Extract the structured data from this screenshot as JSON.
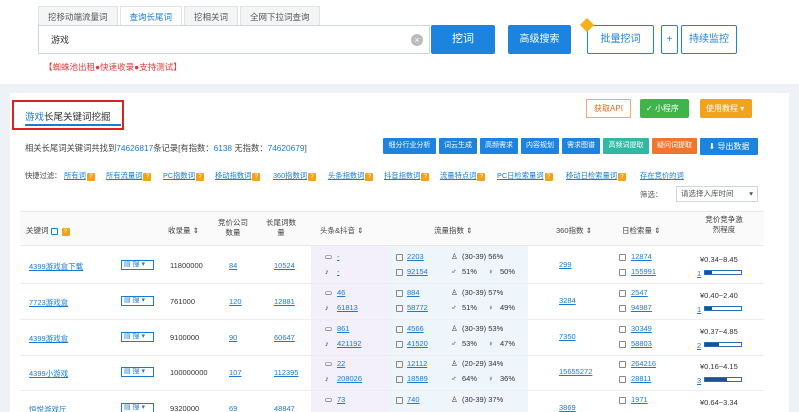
{
  "tabs": [
    "挖移动端流量词",
    "查询长尾词",
    "挖相关词",
    "全网下拉词查询"
  ],
  "search": {
    "value": "游戏"
  },
  "buttons": {
    "dig": "挖词",
    "advanced": "高级搜索",
    "batch": "批量挖词",
    "plus": "+",
    "monitor": "持续监控"
  },
  "promo": "【蜘蛛池出租●快速收录●支持测试】",
  "panel": {
    "title_hl": "游戏",
    "title_rest": "长尾关键词挖掘",
    "get_api": "获取API",
    "mini_program": "小程序",
    "tutorial": "使用教程",
    "summary_pre": "相关长尾词关键词共找到",
    "total": "74626817",
    "summary_mid": "条记录[有指数：",
    "with_index": "6138",
    "summary_mid2": "无指数：",
    "without_index": "74620679",
    "summary_end": "]"
  },
  "tool_buttons": [
    "细分行业分析",
    "词云生成",
    "高频需求",
    "内容规划",
    "需求图谱",
    "高频词提取",
    "疑问词提取",
    "导出数据"
  ],
  "filter": {
    "label": "快捷过滤：",
    "items": [
      "所有词",
      "所有流量词",
      "PC指数词",
      "移动指数词",
      "360指数词",
      "头条指数词",
      "抖音指数词",
      "流量特点词",
      "PC日检索量词",
      "移动日检索量词",
      "存在竞价的词"
    ],
    "select_label": "筛选：",
    "select_value": "请选择入库时间"
  },
  "columns": [
    "关键词",
    "收录量",
    "竞价公司数量",
    "长尾词数量",
    "头条&抖音",
    "流量指数",
    "360指数",
    "日检索量",
    "竞价竞争激烈程度"
  ],
  "rows": [
    {
      "kw": "4399游戏盒下载",
      "shoulu": "11800000",
      "jingjia": "84",
      "changwei": "10524",
      "tt": "-",
      "dy": "-",
      "ll1": "2203",
      "ll2": "92154",
      "age": "(30-39) 56%",
      "male": "51%",
      "female": "50%",
      "s360": "299",
      "day1": "12874",
      "day2": "155991",
      "price": "¥0.34~8.45",
      "level": "1",
      "fill": 0.2
    },
    {
      "kw": "7723游戏盒",
      "shoulu": "761000",
      "jingjia": "120",
      "changwei": "12881",
      "tt": "46",
      "dy": "61813",
      "ll1": "884",
      "ll2": "58772",
      "age": "(30-39) 57%",
      "male": "51%",
      "female": "49%",
      "s360": "3284",
      "day1": "2547",
      "day2": "94987",
      "price": "¥0.40~2.40",
      "level": "1",
      "fill": 0.2
    },
    {
      "kw": "4399游戏盒",
      "shoulu": "9100000",
      "jingjia": "90",
      "changwei": "60647",
      "tt": "861",
      "dy": "421192",
      "ll1": "4566",
      "ll2": "41520",
      "age": "(30-39) 53%",
      "male": "53%",
      "female": "47%",
      "s360": "7350",
      "day1": "30349",
      "day2": "58803",
      "price": "¥0.37~4.85",
      "level": "2",
      "fill": 0.4
    },
    {
      "kw": "4399小游戏",
      "shoulu": "100000000",
      "jingjia": "107",
      "changwei": "112395",
      "tt": "22",
      "dy": "208026",
      "ll1": "12112",
      "ll2": "18589",
      "age": "(20-29) 34%",
      "male": "64%",
      "female": "36%",
      "s360": "15655272",
      "day1": "264216",
      "day2": "28811",
      "price": "¥0.16~4.15",
      "level": "3",
      "fill": 0.6
    },
    {
      "kw": "恒悦游戏厅",
      "shoulu": "9320000",
      "jingjia": "69",
      "changwei": "48847",
      "tt": "73",
      "dy": "",
      "ll1": "740",
      "ll2": "",
      "age": "(30-39) 37%",
      "male": "",
      "female": "",
      "s360": "3869",
      "day1": "1971",
      "day2": "",
      "price": "¥0.64~3.34",
      "level": "",
      "fill": 0.2
    }
  ],
  "colors": {
    "accent": "#1c84de",
    "highlight_border": "#e02020",
    "promo": "#e23a3a",
    "mini": "#3fb549",
    "tutorial": "#f3a21c"
  }
}
